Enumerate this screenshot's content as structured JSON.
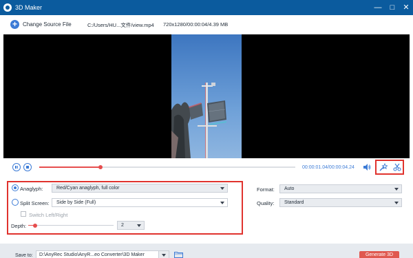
{
  "window": {
    "title": "3D Maker",
    "controls": [
      "minimize-icon",
      "maximize-icon",
      "close-icon"
    ]
  },
  "source": {
    "change_label": "Change Source File",
    "path": "C:/Users/HU...文件/view.mp4",
    "meta": "720x1280/00:00:04/4.39 MB"
  },
  "player": {
    "time": "00:00:01.04/00:00:04.24",
    "progress": 0.24
  },
  "mode": {
    "anaglyph": {
      "label": "Anaglyph:",
      "value": "Red/Cyan anaglyph, full color",
      "selected": true
    },
    "split": {
      "label": "Split Screen:",
      "value": "Side by Side (Full)",
      "selected": false
    },
    "switch_label": "Switch Left/Right",
    "depth_label": "Depth:",
    "depth_value": "2",
    "depth_fraction": 0.08
  },
  "output": {
    "format_label": "Format:",
    "format_value": "Auto",
    "quality_label": "Quality:",
    "quality_value": "Standard"
  },
  "footer": {
    "save_label": "Save to:",
    "save_path": "D:\\AnyRec Studio\\AnyR...eo Converter\\3D Maker",
    "generate_label": "Generate 3D"
  },
  "colors": {
    "titlebar": "#0b5b9e",
    "accent": "#3c7bd6",
    "highlight": "#e0322d",
    "progress": "#e64d4d"
  }
}
